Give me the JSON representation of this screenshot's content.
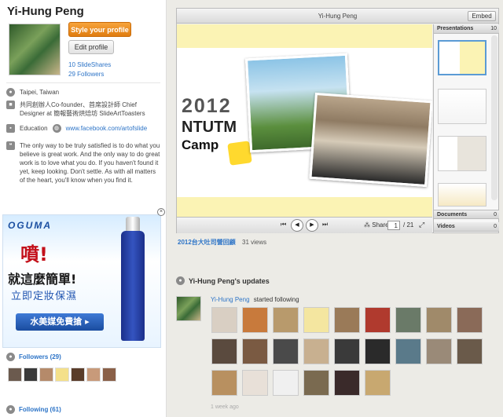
{
  "profile": {
    "name": "Yi-Hung Peng",
    "style_button": "Style your profile",
    "edit_button": "Edit profile",
    "slideshares": "10 SlideShares",
    "followers": "29 Followers",
    "location": "Taipei, Taiwan",
    "bio": "共同創辦人Co-founder、首席設計師 Chief Designer at 簡報藝術烘焙坊 SlideArtToasters",
    "education_label": "Education",
    "website": "www.facebook.com/artofslide",
    "quote": "The only way to be truly satisfied is to do what you believe is great work. And the only way to do great work is to love what you do. If you haven't found it yet, keep looking. Don't settle. As with all matters of the heart, you'll know when you find it."
  },
  "ad": {
    "brand": "OGUMA",
    "line1": "噴!",
    "line2": "就這麼簡單!",
    "line3": "立即定妝保濕",
    "cta": "水美媒免費搶 ▸",
    "close": "×"
  },
  "sidebar_sections": {
    "followers": "Followers (29)",
    "following": "Following (61)"
  },
  "player": {
    "title": "Yi-Hung Peng",
    "embed": "Embed",
    "slide_year": "2012",
    "slide_ntutm": "NTUTM",
    "slide_camp": "Camp",
    "share": "Share",
    "page": "1",
    "total": "/ 21",
    "tabs": {
      "presentations": "Presentations",
      "presentations_count": "10",
      "documents": "Documents",
      "documents_count": "0",
      "videos": "Videos",
      "videos_count": "0"
    }
  },
  "presentation": {
    "title": "2012台大吐司營回顧",
    "views": "31 views"
  },
  "updates": {
    "heading": "Yi-Hung Peng's updates",
    "actor": "Yi-Hung Peng",
    "action": "started following",
    "ago": "1 week ago"
  },
  "colors": {
    "link": "#2d74c7",
    "orange": "#f08c1e",
    "slide_yellow": "#fbf3b4"
  }
}
